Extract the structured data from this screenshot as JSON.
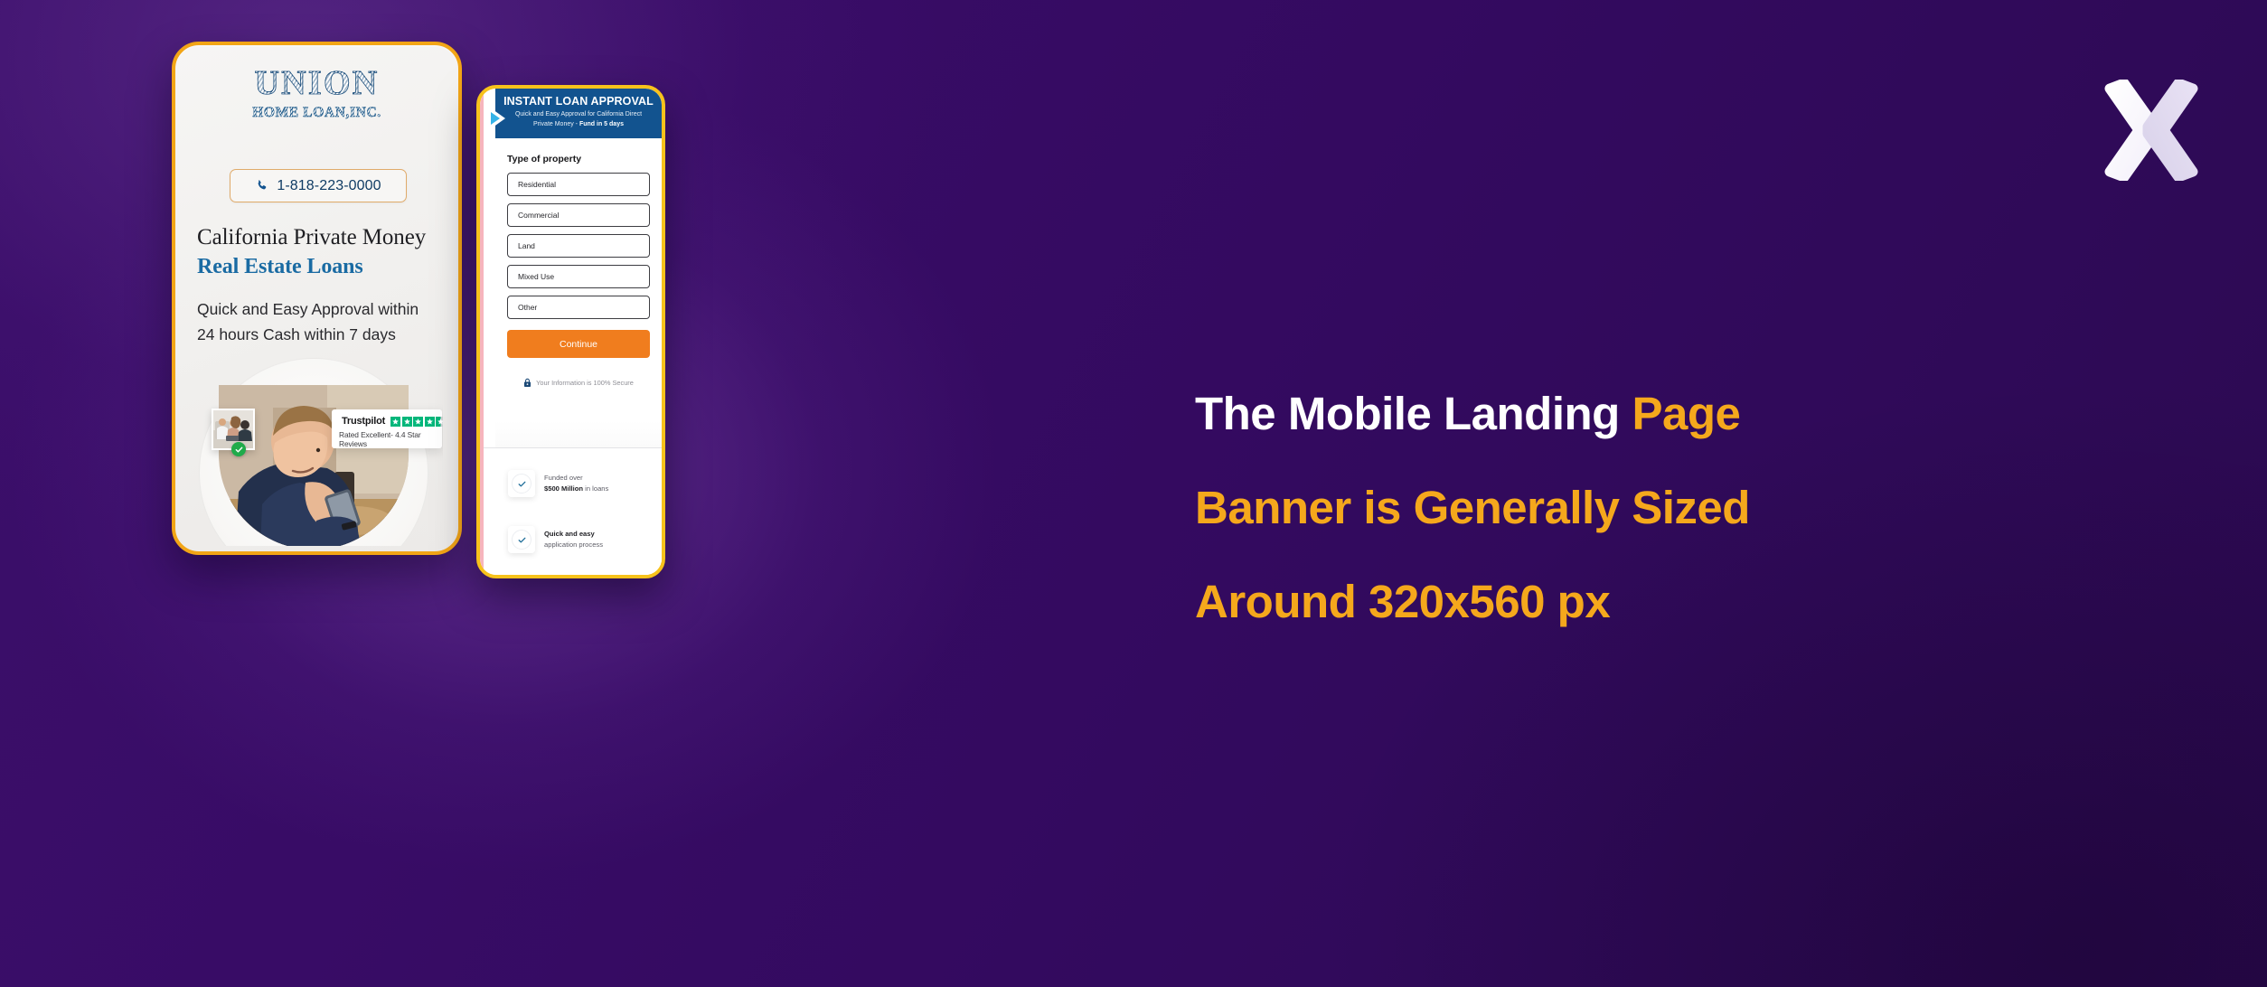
{
  "background": {
    "purple_dark": "#2b0950",
    "purple_light": "#3c0f6b"
  },
  "brand_logo": {
    "icon": "x-chevron-logo",
    "color": "#f2eefb"
  },
  "phone_one": {
    "frame_color": "#f2a516",
    "logo": {
      "line1": "UNION",
      "line2": "HOME LOAN,INC.",
      "color": "#1d4f7c"
    },
    "call_button": {
      "icon": "phone-icon",
      "number": "1-818-223-0000"
    },
    "heading_line1": "California Private Money",
    "heading_line2": "Real Estate Loans",
    "heading_accent_color": "#1a6ba3",
    "subtext_line1": "Quick and Easy Approval within",
    "subtext_line2": "24 hours Cash within 7 days",
    "trustpilot": {
      "name": "Trustpilot",
      "rating_text": "Rated Excellent- 4.4 Star Reviews",
      "stars_full": 4,
      "stars_half": 1,
      "star_color": "#00b67a"
    },
    "mini_card": {
      "badge_icon": "green-check-badge"
    }
  },
  "phone_two": {
    "frame_color": "#f7c21b",
    "banner": {
      "title": "INSTANT LOAN APPROVAL",
      "sub_line1": "Quick and Easy Approval for California Direct",
      "sub_line2_normal": "Private Money - ",
      "sub_line2_bold": "Fund in 5 days",
      "bg_color": "#12538f",
      "arrow_icon": "play-chevron-icon"
    },
    "form": {
      "label": "Type of property",
      "options": [
        "Residential",
        "Commercial",
        "Land",
        "Mixed Use",
        "Other"
      ],
      "cta": "Continue",
      "cta_color": "#f07d1e",
      "secure_icon": "lock-icon",
      "secure_text": "Your Information is 100% Secure"
    },
    "benefits": [
      {
        "icon": "check-circle-icon",
        "line1": "Funded over",
        "line2_bold": "$500 Million",
        "line2_rest": " in loans"
      },
      {
        "icon": "check-circle-icon",
        "line1_bold": "Quick and easy",
        "line2": "application process"
      }
    ]
  },
  "headline": {
    "line1_white": "The Mobile Landing ",
    "line1_accent": "Page",
    "line2": "Banner is Generally Sized",
    "line3": "Around 320x560 px",
    "accent_color": "#f5a81c"
  }
}
